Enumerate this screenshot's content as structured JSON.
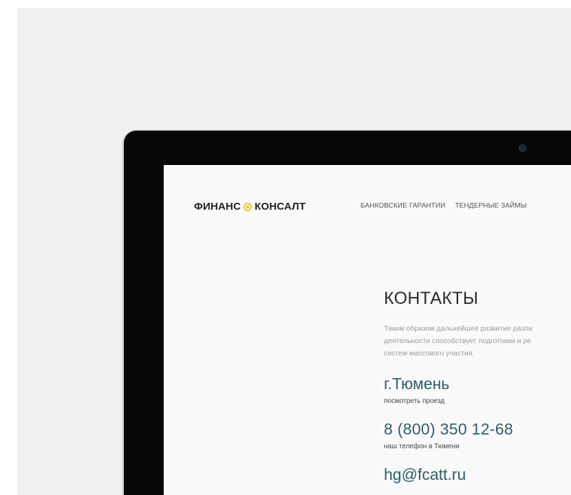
{
  "site": {
    "logo": {
      "left": "ФИНАНС",
      "right": "КОНСАЛТ"
    },
    "nav": [
      {
        "label": "БАНКОВСКИЕ ГАРАНТИИ"
      },
      {
        "label": "ТЕНДЕРНЫЕ ЗАЙМЫ"
      }
    ]
  },
  "contacts": {
    "title": "КОНТАКТЫ",
    "description_lines": [
      "Таким образом дальнейшее развитие разли",
      "деятельности способствует подготовки и ре",
      "систем массового участия."
    ],
    "city": "г.Тюмень",
    "directions_link": "посмотреть проезд",
    "phone": "8 (800) 350 12-68",
    "phone_caption": "наш телефон в Тюмени",
    "email_partial": "hg@fcatt.ru"
  },
  "colors": {
    "accent": "#f2c21a",
    "heading_teal": "#2f5d69",
    "bezel": "#070707",
    "backdrop": "#f0f0f0"
  }
}
